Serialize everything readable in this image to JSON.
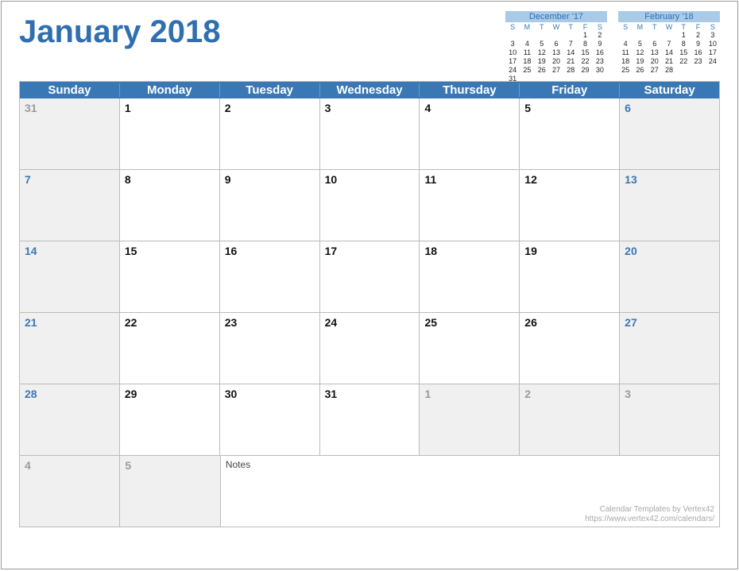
{
  "title": "January 2018",
  "dow": [
    "Sunday",
    "Monday",
    "Tuesday",
    "Wednesday",
    "Thursday",
    "Friday",
    "Saturday"
  ],
  "mini_dow": [
    "S",
    "M",
    "T",
    "W",
    "T",
    "F",
    "S"
  ],
  "mini": [
    {
      "title": "December '17",
      "rows": [
        [
          "",
          "",
          "",
          "",
          "",
          "1",
          "2"
        ],
        [
          "3",
          "4",
          "5",
          "6",
          "7",
          "8",
          "9"
        ],
        [
          "10",
          "11",
          "12",
          "13",
          "14",
          "15",
          "16"
        ],
        [
          "17",
          "18",
          "19",
          "20",
          "21",
          "22",
          "23"
        ],
        [
          "24",
          "25",
          "26",
          "27",
          "28",
          "29",
          "30"
        ],
        [
          "31",
          "",
          "",
          "",
          "",
          "",
          ""
        ]
      ]
    },
    {
      "title": "February '18",
      "rows": [
        [
          "",
          "",
          "",
          "",
          "1",
          "2",
          "3"
        ],
        [
          "4",
          "5",
          "6",
          "7",
          "8",
          "9",
          "10"
        ],
        [
          "11",
          "12",
          "13",
          "14",
          "15",
          "16",
          "17"
        ],
        [
          "18",
          "19",
          "20",
          "21",
          "22",
          "23",
          "24"
        ],
        [
          "25",
          "26",
          "27",
          "28",
          "",
          "",
          ""
        ],
        [
          "",
          "",
          "",
          "",
          "",
          "",
          ""
        ]
      ]
    }
  ],
  "weeks": [
    [
      {
        "n": "31",
        "t": "other"
      },
      {
        "n": "1",
        "t": "in"
      },
      {
        "n": "2",
        "t": "in"
      },
      {
        "n": "3",
        "t": "in"
      },
      {
        "n": "4",
        "t": "in"
      },
      {
        "n": "5",
        "t": "in"
      },
      {
        "n": "6",
        "t": "wk"
      }
    ],
    [
      {
        "n": "7",
        "t": "wk"
      },
      {
        "n": "8",
        "t": "in"
      },
      {
        "n": "9",
        "t": "in"
      },
      {
        "n": "10",
        "t": "in"
      },
      {
        "n": "11",
        "t": "in"
      },
      {
        "n": "12",
        "t": "in"
      },
      {
        "n": "13",
        "t": "wk"
      }
    ],
    [
      {
        "n": "14",
        "t": "wk"
      },
      {
        "n": "15",
        "t": "in"
      },
      {
        "n": "16",
        "t": "in"
      },
      {
        "n": "17",
        "t": "in"
      },
      {
        "n": "18",
        "t": "in"
      },
      {
        "n": "19",
        "t": "in"
      },
      {
        "n": "20",
        "t": "wk"
      }
    ],
    [
      {
        "n": "21",
        "t": "wk"
      },
      {
        "n": "22",
        "t": "in"
      },
      {
        "n": "23",
        "t": "in"
      },
      {
        "n": "24",
        "t": "in"
      },
      {
        "n": "25",
        "t": "in"
      },
      {
        "n": "26",
        "t": "in"
      },
      {
        "n": "27",
        "t": "wk"
      }
    ],
    [
      {
        "n": "28",
        "t": "wk"
      },
      {
        "n": "29",
        "t": "in"
      },
      {
        "n": "30",
        "t": "in"
      },
      {
        "n": "31",
        "t": "in"
      },
      {
        "n": "1",
        "t": "other"
      },
      {
        "n": "2",
        "t": "other"
      },
      {
        "n": "3",
        "t": "other"
      }
    ]
  ],
  "bottom": [
    {
      "n": "4",
      "t": "other"
    },
    {
      "n": "5",
      "t": "other"
    }
  ],
  "notes_label": "Notes",
  "attribution": {
    "line1": "Calendar Templates by Vertex42",
    "line2": "https://www.vertex42.com/calendars/"
  }
}
